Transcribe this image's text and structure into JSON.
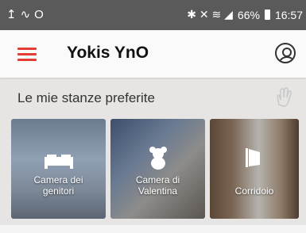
{
  "status_bar": {
    "left_icons": [
      "↥",
      "∿",
      "O"
    ],
    "right_icons": "✱ ✕ ≋ ◢",
    "battery": "66%",
    "time": "16:57"
  },
  "app_bar": {
    "title": "Yokis YnO",
    "menu_icon": "hamburger-icon",
    "profile_icon": "account-icon"
  },
  "section": {
    "title": "Le mie stanze preferite",
    "side_icon": "touch-gesture-icon"
  },
  "rooms": [
    {
      "label_line1": "Camera dei",
      "label_line2": "genitori",
      "icon": "bed-icon"
    },
    {
      "label_line1": "Camera di",
      "label_line2": "Valentina",
      "icon": "teddy-bear-icon"
    },
    {
      "label_line1": "Corridoio",
      "label_line2": "",
      "icon": "door-icon"
    }
  ],
  "colors": {
    "accent": "#e43b32",
    "status_bar": "#5a5a5a",
    "background": "#e6e5e3"
  }
}
